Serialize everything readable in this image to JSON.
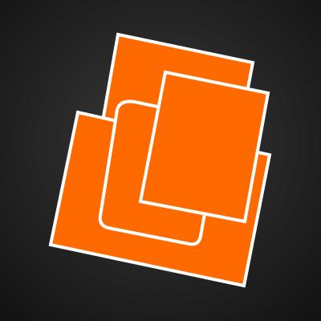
{
  "icon": {
    "name": "stacked-pages-icon",
    "colors": {
      "background_center": "#3a3a3a",
      "background_edge": "#141414",
      "page_fill": "#ff6a00",
      "page_outline": "#ffffff"
    }
  }
}
